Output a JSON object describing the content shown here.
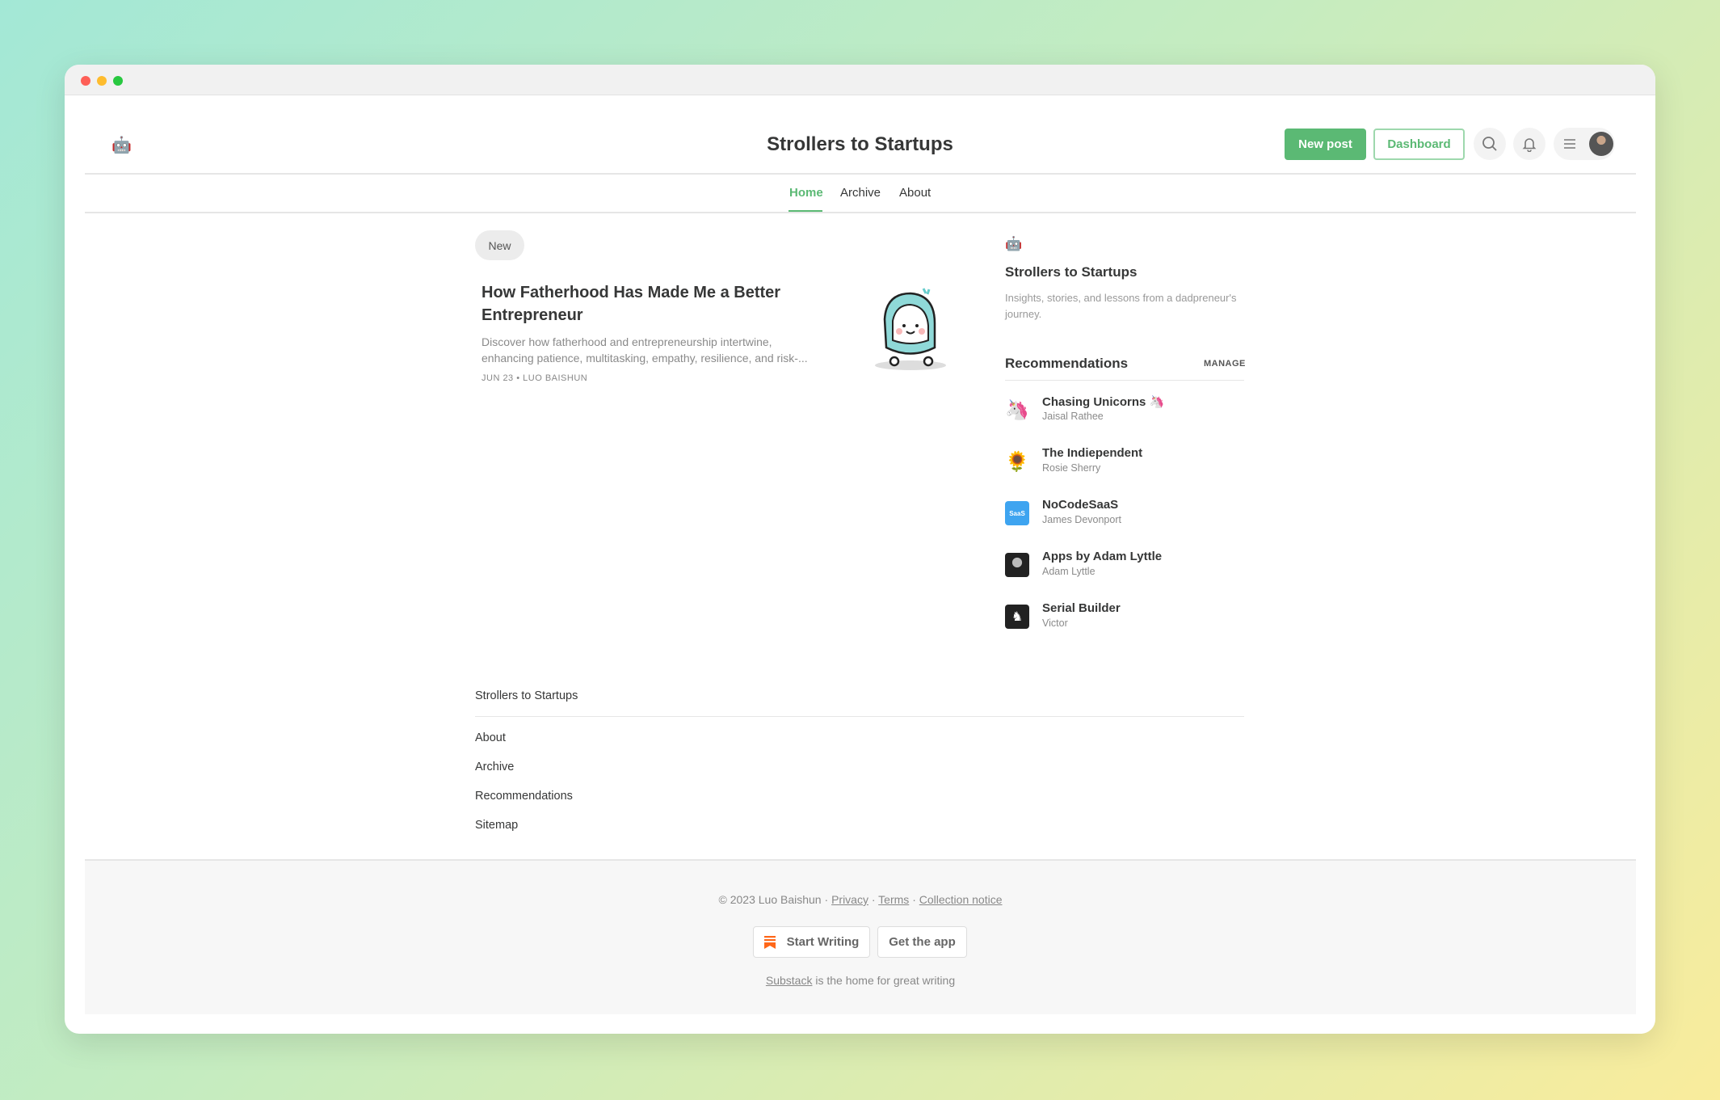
{
  "header": {
    "title": "Strollers to Startups",
    "new_post": "New post",
    "dashboard": "Dashboard"
  },
  "nav": {
    "tabs": [
      {
        "label": "Home",
        "active": true
      },
      {
        "label": "Archive"
      },
      {
        "label": "About"
      }
    ]
  },
  "post": {
    "badge": "New",
    "title_line1": "How Fatherhood Has Made Me a Better",
    "title_line2": "Entrepreneur",
    "desc_line1": "Discover how fatherhood and entrepreneurship intertwine,",
    "desc_line2": "enhancing patience, multitasking, empathy, resilience, and risk-...",
    "meta": "JUN 23 • LUO BAISHUN"
  },
  "sidebar": {
    "title": "Strollers to Startups",
    "desc_line1": "Insights, stories, and lessons from a dadpreneur's",
    "desc_line2": "journey.",
    "rec_heading": "Recommendations",
    "manage": "MANAGE",
    "items": [
      {
        "name": "Chasing Unicorns 🦄",
        "author": "Jaisal Rathee",
        "icon": "unicorn-icon"
      },
      {
        "name": "The Indiependent",
        "author": "Rosie Sherry",
        "icon": "sunflower-icon"
      },
      {
        "name": "NoCodeSaaS",
        "author": "James Devonport",
        "icon": "nocodesaas-logo"
      },
      {
        "name": "Apps by Adam Lyttle",
        "author": "Adam Lyttle",
        "icon": "avatar-photo"
      },
      {
        "name": "Serial Builder",
        "author": "Victor",
        "icon": "serial-builder-logo"
      }
    ]
  },
  "footer_nav": {
    "title": "Strollers to Startups",
    "links": [
      "About",
      "Archive",
      "Recommendations",
      "Sitemap"
    ]
  },
  "footer": {
    "copyright": "© 2023 Luo Baishun",
    "sep": "·",
    "privacy": "Privacy",
    "terms": "Terms",
    "collection": "Collection notice",
    "start_writing": "Start Writing",
    "get_app": "Get the app",
    "substack": "Substack",
    "tagline": " is the home for great writing"
  },
  "colors": {
    "accent": "#5bb974",
    "substack_orange": "#ff6719"
  }
}
